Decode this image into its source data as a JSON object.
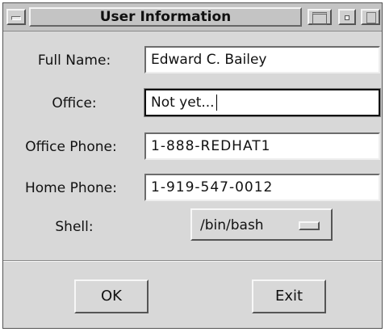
{
  "window": {
    "title": "User Information"
  },
  "form": {
    "full_name": {
      "label": "Full Name:",
      "value": "Edward C. Bailey"
    },
    "office": {
      "label": "Office:",
      "value": "Not yet..."
    },
    "office_phone": {
      "label": "Office Phone:",
      "value": "1-888-REDHAT1"
    },
    "home_phone": {
      "label": "Home Phone:",
      "value": "1-919-547-0012"
    },
    "shell": {
      "label": "Shell:",
      "value": "/bin/bash"
    }
  },
  "buttons": {
    "ok": "OK",
    "exit": "Exit"
  },
  "icons": {
    "window_menu": "window-menu-icon",
    "maximize": "maximize-icon",
    "minimize": "minimize-icon",
    "restore": "restore-icon",
    "option_indicator": "option-menu-indicator-icon"
  }
}
